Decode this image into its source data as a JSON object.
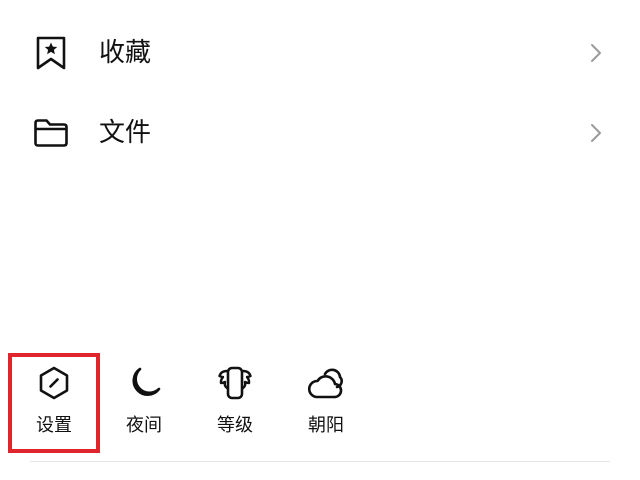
{
  "menu": {
    "items": [
      {
        "label": "收藏",
        "icon": "bookmark-star-icon"
      },
      {
        "label": "文件",
        "icon": "folder-icon"
      }
    ]
  },
  "tools": {
    "items": [
      {
        "label": "设置",
        "icon": "settings-hexagon-icon"
      },
      {
        "label": "夜间",
        "icon": "moon-icon"
      },
      {
        "label": "等级",
        "icon": "level-badge-icon"
      },
      {
        "label": "朝阳",
        "icon": "cloud-sun-icon"
      }
    ]
  },
  "colors": {
    "highlight": "#e0262c",
    "text": "#111111",
    "chevron": "#9a9a9a",
    "divider": "#e6e6e6"
  }
}
